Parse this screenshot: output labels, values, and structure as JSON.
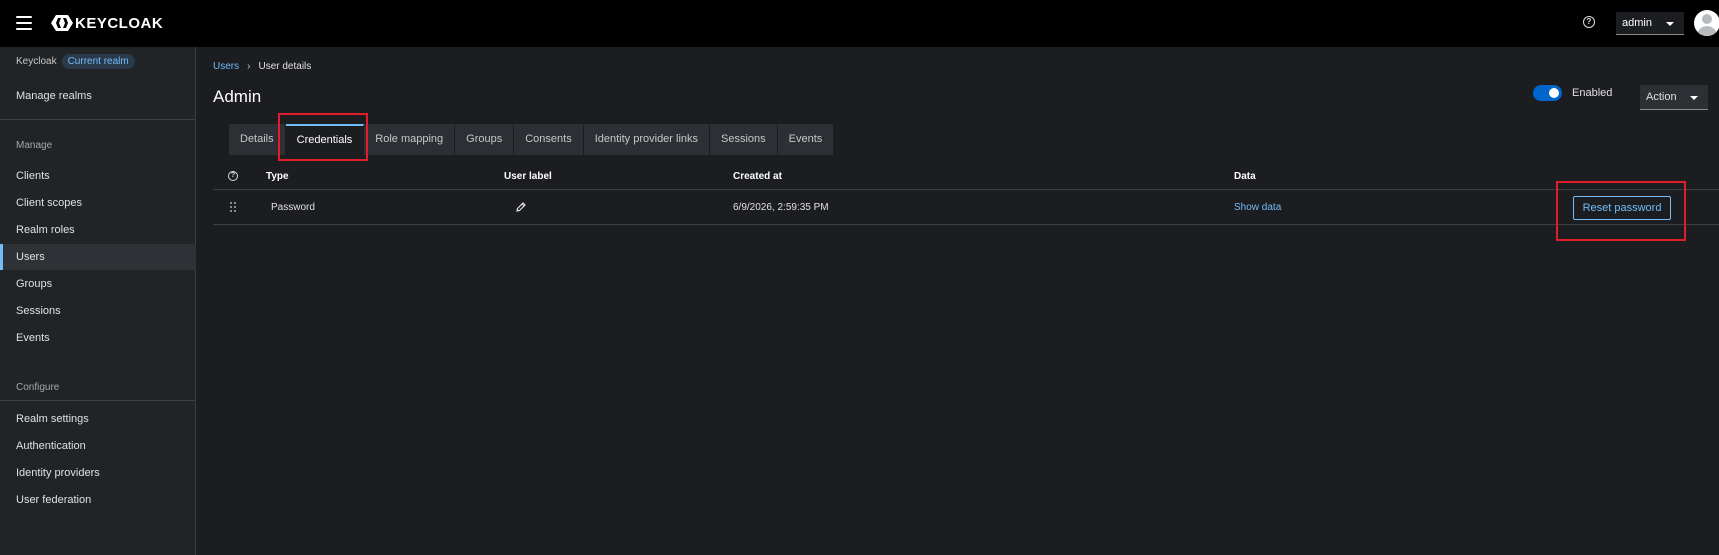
{
  "header": {
    "logo_text": "KEYCLOAK",
    "user_menu_label": "admin"
  },
  "sidebar": {
    "realm_name": "Keycloak",
    "realm_badge": "Current realm",
    "manage_realms": "Manage realms",
    "manage_section": "Manage",
    "manage_items": [
      "Clients",
      "Client scopes",
      "Realm roles",
      "Users",
      "Groups",
      "Sessions",
      "Events"
    ],
    "active_item": "Users",
    "configure_section": "Configure",
    "configure_items": [
      "Realm settings",
      "Authentication",
      "Identity providers",
      "User federation"
    ]
  },
  "breadcrumb": {
    "link": "Users",
    "current": "User details"
  },
  "page": {
    "title": "Admin",
    "enabled_label": "Enabled",
    "enabled": true,
    "action_label": "Action"
  },
  "tabs": [
    "Details",
    "Credentials",
    "Role mapping",
    "Groups",
    "Consents",
    "Identity provider links",
    "Sessions",
    "Events"
  ],
  "active_tab": "Credentials",
  "table": {
    "columns": [
      "Type",
      "User label",
      "Created at",
      "Data"
    ],
    "rows": [
      {
        "type": "Password",
        "created_at": "6/9/2026, 2:59:35 PM",
        "data_link": "Show data",
        "action": "Reset password"
      }
    ]
  },
  "colors": {
    "accent": "#73bcf7",
    "highlight": "#e21b2d",
    "toggle_on": "#0066cc"
  }
}
